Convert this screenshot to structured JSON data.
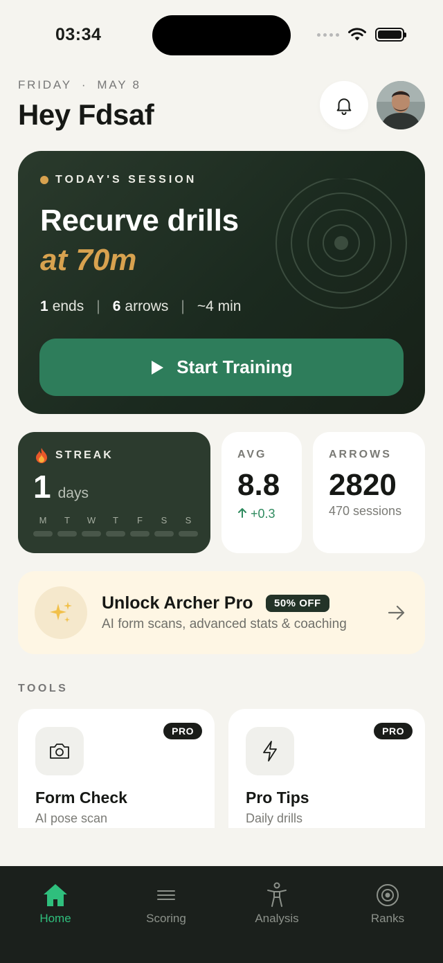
{
  "status_bar": {
    "time": "03:34"
  },
  "header": {
    "weekday": "FRIDAY",
    "separator": "·",
    "date": "MAY 8",
    "greeting": "Hey Fdsaf"
  },
  "session": {
    "tag": "TODAY'S SESSION",
    "title": "Recurve drills",
    "distance": "at 70m",
    "ends_count": "1",
    "ends_label": "ends",
    "arrows_count": "6",
    "arrows_label": "arrows",
    "duration": "~4 min",
    "separator": "|",
    "start_label": "Start Training"
  },
  "streak": {
    "label": "STREAK",
    "count": "1",
    "unit": "days",
    "days": [
      "M",
      "T",
      "W",
      "T",
      "F",
      "S",
      "S"
    ]
  },
  "avg": {
    "label": "AVG",
    "value": "8.8",
    "delta": "+0.3"
  },
  "arrows": {
    "label": "ARROWS",
    "value": "2820",
    "sessions": "470 sessions"
  },
  "promo": {
    "title": "Unlock Archer Pro",
    "badge": "50% OFF",
    "subtitle": "AI form scans, advanced stats & coaching"
  },
  "tools": {
    "heading": "TOOLS",
    "items": [
      {
        "title": "Form Check",
        "subtitle": "AI pose scan",
        "badge": "PRO",
        "icon": "camera-icon"
      },
      {
        "title": "Pro Tips",
        "subtitle": "Daily drills",
        "badge": "PRO",
        "icon": "lightning-icon"
      }
    ]
  },
  "tab_bar": {
    "tabs": [
      {
        "label": "Home",
        "icon": "home-icon",
        "active": true
      },
      {
        "label": "Scoring",
        "icon": "menu-lines-icon",
        "active": false
      },
      {
        "label": "Analysis",
        "icon": "person-icon",
        "active": false
      },
      {
        "label": "Ranks",
        "icon": "target-icon",
        "active": false
      }
    ]
  },
  "colors": {
    "background": "#F5F4EF",
    "session_card": "#1F2E22",
    "accent_gold": "#D8A24F",
    "primary_green": "#2E7D5B",
    "active_tab": "#2FBF7D",
    "promo_bg": "#FEF6E4"
  }
}
